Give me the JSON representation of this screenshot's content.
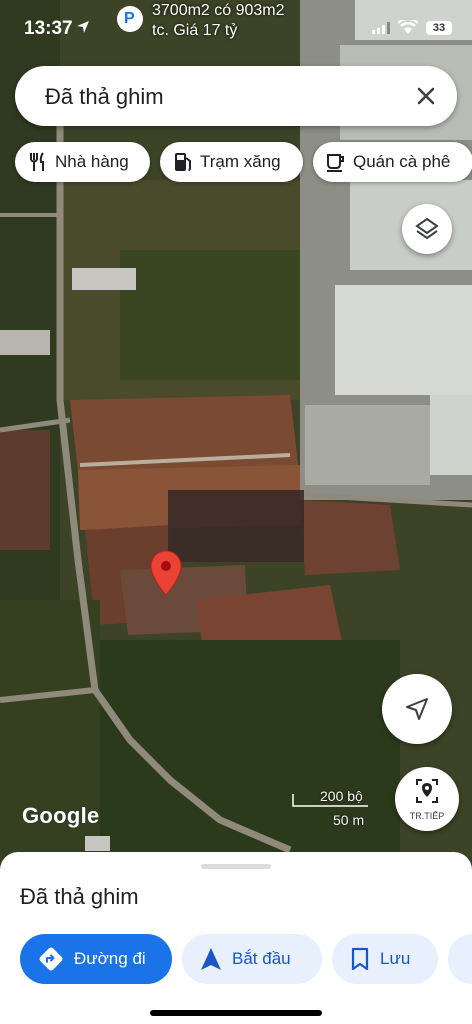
{
  "status_bar": {
    "time": "13:37",
    "notification_line1": "3700m2 có 903m2",
    "notification_line2": "tc. Giá 17 tỷ",
    "battery": "33"
  },
  "search": {
    "text": "Đã thả ghim"
  },
  "chips": [
    {
      "label": "Nhà hàng",
      "icon": "restaurant-icon"
    },
    {
      "label": "Trạm xăng",
      "icon": "gas-station-icon"
    },
    {
      "label": "Quán cà phê",
      "icon": "coffee-icon"
    }
  ],
  "map": {
    "attribution": "Google",
    "scale_top": "200 bộ",
    "scale_bottom": "50 m",
    "next_button_label": "TR.TIẾP"
  },
  "sheet": {
    "title": "Đã thả ghim",
    "actions": [
      {
        "label": "Đường đi",
        "icon": "directions-icon",
        "primary": true
      },
      {
        "label": "Bắt đầu",
        "icon": "navigation-arrow-icon"
      },
      {
        "label": "Lưu",
        "icon": "bookmark-icon"
      }
    ]
  },
  "colors": {
    "accent": "#1a73e8",
    "pin": "#ea4335"
  }
}
